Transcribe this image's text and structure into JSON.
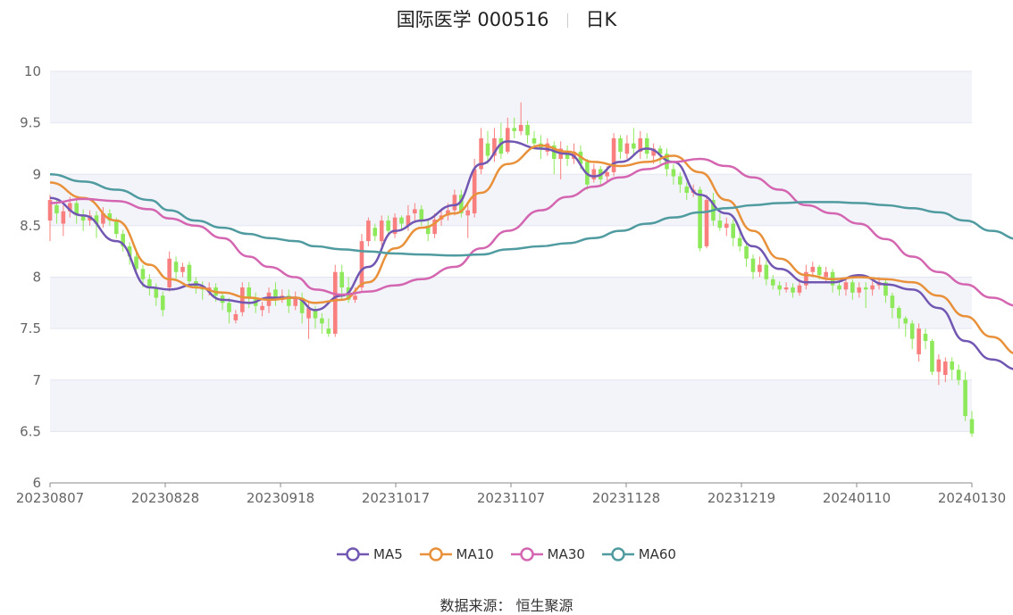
{
  "header": {
    "stock_name": "国际医学 000516",
    "period": "日K"
  },
  "source": {
    "text": "数据来源：  恒生聚源"
  },
  "colors": {
    "up": "#f87f7e",
    "down": "#8de85a",
    "ma5": "#7157b2",
    "ma10": "#e8903a",
    "ma30": "#d466b1",
    "ma60": "#4f9ba0",
    "band": "#f3f4fa",
    "grid": "#e3e6f0",
    "axis": "#666666"
  },
  "chart_data": {
    "type": "candlestick",
    "ylim": [
      6,
      10
    ],
    "yticks": [
      "6",
      "6.5",
      "7",
      "7.5",
      "8",
      "8.5",
      "9",
      "9.5",
      "10"
    ],
    "xticks": [
      "20230807",
      "20230828",
      "20230918",
      "20231017",
      "20231107",
      "20231128",
      "20231219",
      "20240110",
      "20240130"
    ],
    "legend": [
      "MA5",
      "MA10",
      "MA30",
      "MA60"
    ],
    "ma_series": {
      "MA5": [
        [
          0,
          8.77
        ],
        [
          5,
          8.6
        ],
        [
          10,
          8.35
        ],
        [
          15,
          7.9
        ],
        [
          18,
          7.88
        ],
        [
          22,
          7.93
        ],
        [
          26,
          7.78
        ],
        [
          30,
          7.75
        ],
        [
          33,
          7.8
        ],
        [
          37,
          7.8
        ],
        [
          40,
          7.68
        ],
        [
          44,
          7.82
        ],
        [
          48,
          8.1
        ],
        [
          52,
          8.45
        ],
        [
          56,
          8.55
        ],
        [
          61,
          8.7
        ],
        [
          65,
          9.1
        ],
        [
          69,
          9.32
        ],
        [
          74,
          9.25
        ],
        [
          78,
          9.2
        ],
        [
          82,
          8.98
        ],
        [
          86,
          9.12
        ],
        [
          90,
          9.25
        ],
        [
          94,
          9.12
        ],
        [
          98,
          8.8
        ],
        [
          102,
          8.62
        ],
        [
          106,
          8.3
        ],
        [
          110,
          8.08
        ],
        [
          114,
          7.95
        ],
        [
          118,
          7.95
        ],
        [
          122,
          8.02
        ],
        [
          126,
          7.93
        ],
        [
          130,
          7.88
        ],
        [
          134,
          7.7
        ],
        [
          138,
          7.38
        ],
        [
          142,
          7.2
        ],
        [
          146,
          7.1
        ],
        [
          149,
          6.88
        ]
      ],
      "MA10": [
        [
          0,
          8.92
        ],
        [
          5,
          8.77
        ],
        [
          10,
          8.55
        ],
        [
          15,
          8.12
        ],
        [
          18,
          7.98
        ],
        [
          22,
          7.9
        ],
        [
          26,
          7.85
        ],
        [
          30,
          7.8
        ],
        [
          33,
          7.78
        ],
        [
          37,
          7.8
        ],
        [
          40,
          7.75
        ],
        [
          44,
          7.78
        ],
        [
          48,
          7.95
        ],
        [
          52,
          8.28
        ],
        [
          56,
          8.48
        ],
        [
          61,
          8.62
        ],
        [
          65,
          8.82
        ],
        [
          69,
          9.1
        ],
        [
          74,
          9.28
        ],
        [
          78,
          9.22
        ],
        [
          82,
          9.12
        ],
        [
          86,
          9.08
        ],
        [
          90,
          9.12
        ],
        [
          94,
          9.18
        ],
        [
          98,
          9.02
        ],
        [
          102,
          8.75
        ],
        [
          106,
          8.45
        ],
        [
          110,
          8.18
        ],
        [
          114,
          8.02
        ],
        [
          118,
          7.98
        ],
        [
          122,
          8.0
        ],
        [
          126,
          7.98
        ],
        [
          130,
          7.95
        ],
        [
          134,
          7.82
        ],
        [
          138,
          7.62
        ],
        [
          142,
          7.42
        ],
        [
          146,
          7.25
        ],
        [
          149,
          7.08
        ]
      ],
      "MA30": [
        [
          0,
          8.72
        ],
        [
          5,
          8.76
        ],
        [
          10,
          8.74
        ],
        [
          15,
          8.66
        ],
        [
          18,
          8.57
        ],
        [
          22,
          8.5
        ],
        [
          26,
          8.38
        ],
        [
          30,
          8.2
        ],
        [
          33,
          8.1
        ],
        [
          37,
          8.0
        ],
        [
          40,
          7.88
        ],
        [
          44,
          7.83
        ],
        [
          48,
          7.86
        ],
        [
          52,
          7.92
        ],
        [
          56,
          7.98
        ],
        [
          61,
          8.1
        ],
        [
          65,
          8.28
        ],
        [
          69,
          8.45
        ],
        [
          74,
          8.65
        ],
        [
          78,
          8.78
        ],
        [
          82,
          8.88
        ],
        [
          86,
          8.97
        ],
        [
          90,
          9.05
        ],
        [
          94,
          9.12
        ],
        [
          98,
          9.15
        ],
        [
          102,
          9.08
        ],
        [
          106,
          8.97
        ],
        [
          110,
          8.85
        ],
        [
          114,
          8.7
        ],
        [
          118,
          8.62
        ],
        [
          122,
          8.52
        ],
        [
          126,
          8.37
        ],
        [
          130,
          8.2
        ],
        [
          134,
          8.05
        ],
        [
          138,
          7.93
        ],
        [
          142,
          7.8
        ],
        [
          146,
          7.72
        ],
        [
          149,
          7.65
        ]
      ],
      "MA60": [
        [
          0,
          9.0
        ],
        [
          5,
          8.93
        ],
        [
          10,
          8.85
        ],
        [
          15,
          8.75
        ],
        [
          18,
          8.65
        ],
        [
          22,
          8.55
        ],
        [
          26,
          8.48
        ],
        [
          30,
          8.42
        ],
        [
          33,
          8.38
        ],
        [
          37,
          8.35
        ],
        [
          40,
          8.3
        ],
        [
          44,
          8.27
        ],
        [
          48,
          8.25
        ],
        [
          52,
          8.23
        ],
        [
          56,
          8.22
        ],
        [
          61,
          8.21
        ],
        [
          65,
          8.22
        ],
        [
          69,
          8.27
        ],
        [
          74,
          8.3
        ],
        [
          78,
          8.33
        ],
        [
          82,
          8.38
        ],
        [
          86,
          8.45
        ],
        [
          90,
          8.52
        ],
        [
          94,
          8.58
        ],
        [
          98,
          8.63
        ],
        [
          102,
          8.67
        ],
        [
          106,
          8.7
        ],
        [
          110,
          8.72
        ],
        [
          114,
          8.73
        ],
        [
          118,
          8.73
        ],
        [
          122,
          8.72
        ],
        [
          126,
          8.7
        ],
        [
          130,
          8.67
        ],
        [
          134,
          8.63
        ],
        [
          138,
          8.55
        ],
        [
          142,
          8.45
        ],
        [
          146,
          8.37
        ],
        [
          149,
          8.3
        ]
      ]
    },
    "candles": [
      [
        8.55,
        8.75,
        8.35,
        8.8
      ],
      [
        8.7,
        8.62,
        8.52,
        8.75
      ],
      [
        8.52,
        8.64,
        8.4,
        8.7
      ],
      [
        8.64,
        8.72,
        8.58,
        8.78
      ],
      [
        8.72,
        8.6,
        8.52,
        8.76
      ],
      [
        8.6,
        8.55,
        8.45,
        8.66
      ],
      [
        8.55,
        8.6,
        8.5,
        8.65
      ],
      [
        8.6,
        8.52,
        8.38,
        8.64
      ],
      [
        8.52,
        8.62,
        8.48,
        8.68
      ],
      [
        8.62,
        8.55,
        8.5,
        8.66
      ],
      [
        8.55,
        8.42,
        8.38,
        8.58
      ],
      [
        8.42,
        8.3,
        8.25,
        8.46
      ],
      [
        8.3,
        8.2,
        8.12,
        8.34
      ],
      [
        8.2,
        8.08,
        8.02,
        8.24
      ],
      [
        8.08,
        7.98,
        7.9,
        8.12
      ],
      [
        7.98,
        7.9,
        7.82,
        8.03
      ],
      [
        7.9,
        7.8,
        7.72,
        7.94
      ],
      [
        7.82,
        7.68,
        7.62,
        7.86
      ],
      [
        7.9,
        8.18,
        7.86,
        8.25
      ],
      [
        8.15,
        8.05,
        7.98,
        8.2
      ],
      [
        8.05,
        8.1,
        8.0,
        8.14
      ],
      [
        8.12,
        7.96,
        7.9,
        8.15
      ],
      [
        7.96,
        7.9,
        7.84,
        8.0
      ],
      [
        7.9,
        7.88,
        7.78,
        7.96
      ],
      [
        7.88,
        7.9,
        7.82,
        7.95
      ],
      [
        7.9,
        7.82,
        7.76,
        7.94
      ],
      [
        7.82,
        7.75,
        7.68,
        7.86
      ],
      [
        7.75,
        7.66,
        7.55,
        7.8
      ],
      [
        7.58,
        7.64,
        7.55,
        7.68
      ],
      [
        7.66,
        7.9,
        7.62,
        7.95
      ],
      [
        7.9,
        7.8,
        7.7,
        7.95
      ],
      [
        7.8,
        7.72,
        7.65,
        7.85
      ],
      [
        7.68,
        7.72,
        7.62,
        7.76
      ],
      [
        7.72,
        7.85,
        7.65,
        7.9
      ],
      [
        7.88,
        7.78,
        7.72,
        7.95
      ],
      [
        7.78,
        7.82,
        7.75,
        7.88
      ],
      [
        7.82,
        7.72,
        7.65,
        7.88
      ],
      [
        7.72,
        7.8,
        7.68,
        7.86
      ],
      [
        7.8,
        7.65,
        7.55,
        7.85
      ],
      [
        7.6,
        7.7,
        7.4,
        7.75
      ],
      [
        7.68,
        7.6,
        7.5,
        7.72
      ],
      [
        7.6,
        7.55,
        7.45,
        7.65
      ],
      [
        7.5,
        7.45,
        7.42,
        7.6
      ],
      [
        7.45,
        8.05,
        7.42,
        8.12
      ],
      [
        8.05,
        7.9,
        7.78,
        8.12
      ],
      [
        7.9,
        7.78,
        7.75,
        8.0
      ],
      [
        7.78,
        7.82,
        7.75,
        7.9
      ],
      [
        7.9,
        8.35,
        7.86,
        8.42
      ],
      [
        8.35,
        8.55,
        8.3,
        8.58
      ],
      [
        8.48,
        8.4,
        8.35,
        8.52
      ],
      [
        8.35,
        8.55,
        8.3,
        8.6
      ],
      [
        8.55,
        8.45,
        8.4,
        8.6
      ],
      [
        8.42,
        8.58,
        8.38,
        8.62
      ],
      [
        8.58,
        8.52,
        8.45,
        8.6
      ],
      [
        8.5,
        8.6,
        8.45,
        8.7
      ],
      [
        8.62,
        8.66,
        8.55,
        8.72
      ],
      [
        8.66,
        8.56,
        8.5,
        8.7
      ],
      [
        8.5,
        8.42,
        8.35,
        8.56
      ],
      [
        8.42,
        8.56,
        8.38,
        8.62
      ],
      [
        8.56,
        8.6,
        8.5,
        8.66
      ],
      [
        8.6,
        8.65,
        8.55,
        8.72
      ],
      [
        8.65,
        8.8,
        8.6,
        8.85
      ],
      [
        8.8,
        8.62,
        8.58,
        8.85
      ],
      [
        8.6,
        8.65,
        8.38,
        8.72
      ],
      [
        8.62,
        9.05,
        8.58,
        9.15
      ],
      [
        9.05,
        9.35,
        9.0,
        9.45
      ],
      [
        9.3,
        9.18,
        9.1,
        9.42
      ],
      [
        9.18,
        9.35,
        9.12,
        9.45
      ],
      [
        9.35,
        9.2,
        9.15,
        9.5
      ],
      [
        9.22,
        9.45,
        9.2,
        9.55
      ],
      [
        9.45,
        9.42,
        9.35,
        9.55
      ],
      [
        9.42,
        9.48,
        9.38,
        9.7
      ],
      [
        9.48,
        9.38,
        9.3,
        9.52
      ],
      [
        9.35,
        9.3,
        9.25,
        9.42
      ],
      [
        9.3,
        9.25,
        9.15,
        9.38
      ],
      [
        9.22,
        9.3,
        9.18,
        9.35
      ],
      [
        9.28,
        9.15,
        9.0,
        9.32
      ],
      [
        9.15,
        9.25,
        8.95,
        9.32
      ],
      [
        9.22,
        9.15,
        9.08,
        9.28
      ],
      [
        9.15,
        9.22,
        9.1,
        9.3
      ],
      [
        9.22,
        9.1,
        9.05,
        9.28
      ],
      [
        9.12,
        8.9,
        8.85,
        9.15
      ],
      [
        8.95,
        9.05,
        8.92,
        9.1
      ],
      [
        9.05,
        8.95,
        8.88,
        9.08
      ],
      [
        8.98,
        9.02,
        8.92,
        9.08
      ],
      [
        9.02,
        9.35,
        8.98,
        9.4
      ],
      [
        9.35,
        9.22,
        9.15,
        9.38
      ],
      [
        9.2,
        9.3,
        9.15,
        9.38
      ],
      [
        9.3,
        9.25,
        9.2,
        9.45
      ],
      [
        9.22,
        9.35,
        9.15,
        9.42
      ],
      [
        9.35,
        9.2,
        9.15,
        9.4
      ],
      [
        9.18,
        9.25,
        9.1,
        9.3
      ],
      [
        9.25,
        9.2,
        9.1,
        9.28
      ],
      [
        9.2,
        9.05,
        8.98,
        9.25
      ],
      [
        9.05,
        8.98,
        8.9,
        9.1
      ],
      [
        8.98,
        8.9,
        8.82,
        9.02
      ],
      [
        8.88,
        8.82,
        8.75,
        8.92
      ],
      [
        8.82,
        8.85,
        8.78,
        8.9
      ],
      [
        8.85,
        8.28,
        8.25,
        8.88
      ],
      [
        8.3,
        8.75,
        8.28,
        8.8
      ],
      [
        8.75,
        8.55,
        8.5,
        8.82
      ],
      [
        8.55,
        8.48,
        8.45,
        8.62
      ],
      [
        8.48,
        8.52,
        8.4,
        8.58
      ],
      [
        8.52,
        8.38,
        8.3,
        8.56
      ],
      [
        8.38,
        8.3,
        8.25,
        8.45
      ],
      [
        8.3,
        8.18,
        8.1,
        8.35
      ],
      [
        8.18,
        8.05,
        7.98,
        8.22
      ],
      [
        8.05,
        8.12,
        8.0,
        8.2
      ],
      [
        8.12,
        7.98,
        7.92,
        8.16
      ],
      [
        7.98,
        7.92,
        7.88,
        8.02
      ],
      [
        7.92,
        7.88,
        7.82,
        7.96
      ],
      [
        7.88,
        7.9,
        7.85,
        7.95
      ],
      [
        7.9,
        7.85,
        7.8,
        7.94
      ],
      [
        7.85,
        7.92,
        7.82,
        7.98
      ],
      [
        7.92,
        8.05,
        7.88,
        8.12
      ],
      [
        8.05,
        8.1,
        8.0,
        8.15
      ],
      [
        8.1,
        8.02,
        7.98,
        8.12
      ],
      [
        8.0,
        8.05,
        7.95,
        8.1
      ],
      [
        8.05,
        7.92,
        7.85,
        8.08
      ],
      [
        7.92,
        7.88,
        7.82,
        7.96
      ],
      [
        7.88,
        7.95,
        7.82,
        8.0
      ],
      [
        7.95,
        7.85,
        7.78,
        7.98
      ],
      [
        7.85,
        7.9,
        7.8,
        7.95
      ],
      [
        7.9,
        7.88,
        7.7,
        7.95
      ],
      [
        7.88,
        7.92,
        7.82,
        7.96
      ],
      [
        7.92,
        7.95,
        7.88,
        8.0
      ],
      [
        7.95,
        7.82,
        7.75,
        7.98
      ],
      [
        7.82,
        7.7,
        7.6,
        7.85
      ],
      [
        7.7,
        7.6,
        7.5,
        7.72
      ],
      [
        7.6,
        7.55,
        7.42,
        7.62
      ],
      [
        7.55,
        7.4,
        7.3,
        7.58
      ],
      [
        7.25,
        7.5,
        7.18,
        7.55
      ],
      [
        7.45,
        7.38,
        7.3,
        7.5
      ],
      [
        7.38,
        7.08,
        7.05,
        7.4
      ],
      [
        7.08,
        7.2,
        6.95,
        7.25
      ],
      [
        7.05,
        7.18,
        6.98,
        7.22
      ],
      [
        7.18,
        7.1,
        7.0,
        7.22
      ],
      [
        7.1,
        7.0,
        6.95,
        7.15
      ],
      [
        7.0,
        6.65,
        6.6,
        7.08
      ],
      [
        6.62,
        6.48,
        6.45,
        6.7
      ]
    ]
  }
}
